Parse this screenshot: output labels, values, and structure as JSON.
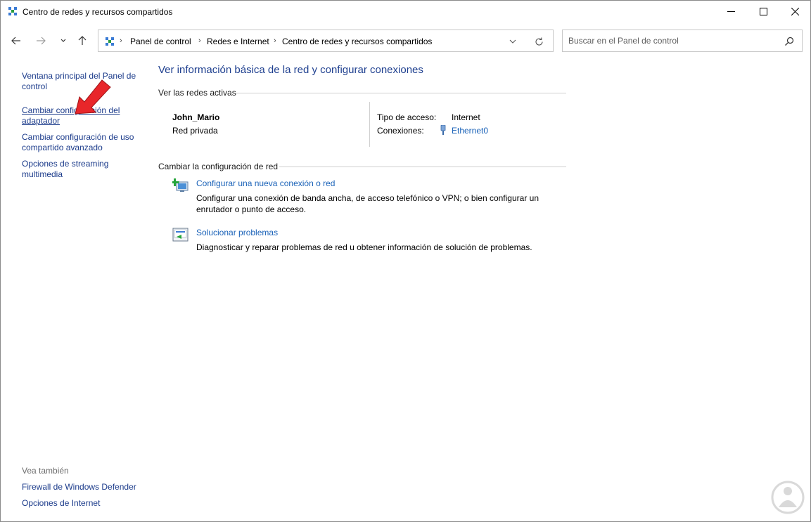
{
  "window": {
    "title": "Centro de redes y recursos compartidos"
  },
  "address": {
    "crumbs": [
      "Panel de control",
      "Redes e Internet",
      "Centro de redes y recursos compartidos"
    ]
  },
  "search": {
    "placeholder": "Buscar en el Panel de control"
  },
  "sidebar": {
    "links": [
      {
        "line1": "Ventana principal del Panel de",
        "line2": "control"
      },
      {
        "line1": "Cambiar configuración del",
        "line2": "adaptador"
      },
      {
        "line1": "Cambiar configuración de uso",
        "line2": "compartido avanzado"
      },
      {
        "line1": "Opciones de streaming",
        "line2": "multimedia"
      }
    ],
    "see_also_title": "Vea también",
    "see_also": [
      "Firewall de Windows Defender",
      "Opciones de Internet"
    ]
  },
  "main": {
    "title": "Ver información básica de la red y configurar conexiones",
    "active_networks_label": "Ver las redes activas",
    "network": {
      "name": "John_Mario",
      "type": "Red privada",
      "access_label": "Tipo de acceso:",
      "access_value": "Internet",
      "connections_label": "Conexiones:",
      "connections_value": "Ethernet0"
    },
    "change_settings_label": "Cambiar la configuración de red",
    "tasks": [
      {
        "link": "Configurar una nueva conexión o red",
        "desc1": "Configurar una conexión de banda ancha, de acceso telefónico o VPN; o bien configurar un",
        "desc2": "enrutador o punto de acceso."
      },
      {
        "link": "Solucionar problemas",
        "desc1": "Diagnosticar y reparar problemas de red u obtener información de solución de problemas.",
        "desc2": ""
      }
    ]
  },
  "colors": {
    "link": "#1a62b8",
    "title": "#1e3f8f",
    "arrow": "#e8262a"
  },
  "icons": [
    "network-icon",
    "back-icon",
    "forward-icon",
    "recent-icon",
    "up-icon",
    "chevron-down-icon",
    "refresh-icon",
    "search-icon",
    "minimize-icon",
    "maximize-icon",
    "close-icon",
    "ethernet-icon",
    "new-connection-icon",
    "troubleshoot-icon",
    "red-arrow-annotation"
  ]
}
